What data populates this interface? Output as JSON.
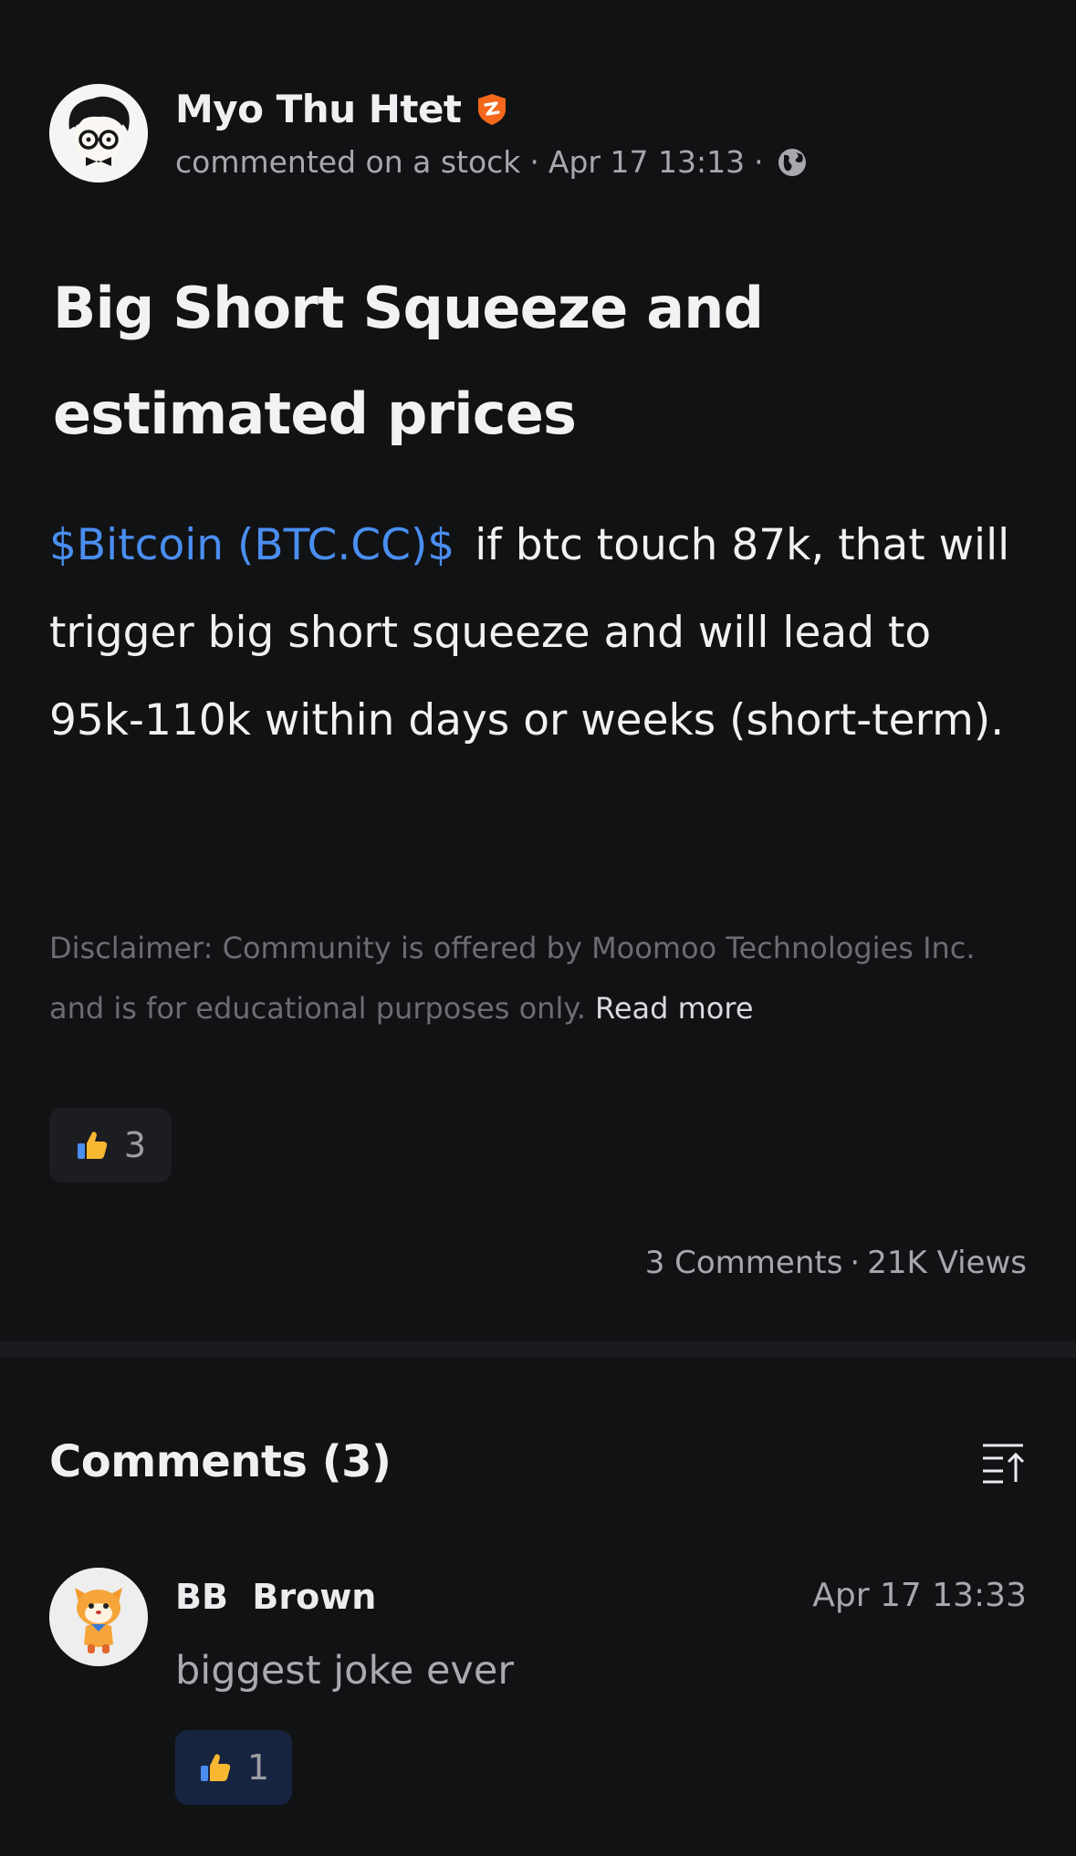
{
  "post": {
    "author": {
      "name": "Myo Thu Htet",
      "avatar": "cartoon-glasses-avatar",
      "badge": "verified-shield-badge"
    },
    "meta": {
      "action": "commented on a stock",
      "separator": "·",
      "time": "Apr 17 13:13",
      "visibility_icon": "globe-icon"
    },
    "title": "Big Short Squeeze and estimated prices",
    "ticker_link": "$Bitcoin (BTC.CC)$",
    "body": "if btc touch 87k, that will trigger big short squeeze and will lead to 95k-110k within days or weeks (short-term).",
    "disclaimer": "Disclaimer: Community is offered by Moomoo Technologies Inc. and is for educational purposes only.",
    "read_more": "Read more",
    "reactions": {
      "icon": "thumbs-up-icon",
      "count": "3"
    },
    "stats": {
      "comments": "3 Comments",
      "separator": "·",
      "views": "21K Views"
    }
  },
  "comments_section": {
    "title": "Comments (3)",
    "sort_icon": "sort-icon",
    "items": [
      {
        "author": "BB  Brown",
        "avatar": "mascot-avatar",
        "time": "Apr 17 13:33",
        "text": "biggest joke ever",
        "likes": "1"
      }
    ]
  },
  "colors": {
    "background": "#111214",
    "link": "#4a8ef0",
    "badge": "#f3681b",
    "muted": "#a7a8ad",
    "comment_like_bg": "#172440"
  }
}
